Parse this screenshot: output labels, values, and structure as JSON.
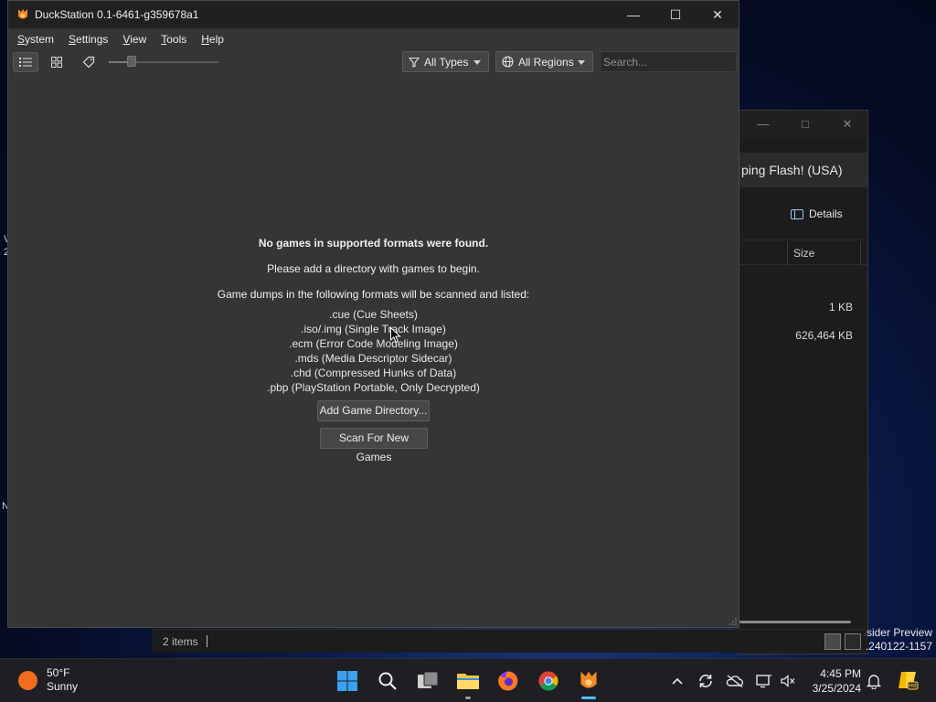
{
  "desktop": {
    "edge_a": "V",
    "edge_b": "2",
    "edge_c": "N",
    "insider_line1": "sider Preview",
    "insider_line2": ".240122-1157"
  },
  "explorer": {
    "address_text": "ping Flash! (USA)",
    "details_label": "Details",
    "size_header": "Size",
    "rows": [
      {
        "size": "1 KB"
      },
      {
        "size": "626,464 KB"
      }
    ],
    "status_items": "2 items"
  },
  "duckstation": {
    "title": "DuckStation 0.1-6461-g359678a1",
    "menu": [
      {
        "label": "System",
        "mnemonic_index": 0
      },
      {
        "label": "Settings",
        "mnemonic_index": 0
      },
      {
        "label": "View",
        "mnemonic_index": 0
      },
      {
        "label": "Tools",
        "mnemonic_index": 0
      },
      {
        "label": "Help",
        "mnemonic_index": 0
      }
    ],
    "toolbar": {
      "type_filter": "All Types",
      "region_filter": "All Regions",
      "search_placeholder": "Search...",
      "zoom_level": 0.17
    },
    "empty_state": {
      "heading": "No games in supported formats were found.",
      "line1": "Please add a directory with games to begin.",
      "line2": "Game dumps in the following formats will be scanned and listed:",
      "formats": [
        ".cue (Cue Sheets)",
        ".iso/.img (Single Track Image)",
        ".ecm (Error Code Modeling Image)",
        ".mds (Media Descriptor Sidecar)",
        ".chd (Compressed Hunks of Data)",
        ".pbp (PlayStation Portable, Only Decrypted)"
      ],
      "add_button": "Add Game Directory...",
      "scan_button": "Scan For New Games"
    }
  },
  "taskbar": {
    "weather_temp": "50°F",
    "weather_desc": "Sunny",
    "time": "4:45 PM",
    "date": "3/25/2024"
  },
  "colors": {
    "window_bg": "#353535",
    "titlebar_bg": "#202020",
    "taskbar_bg": "#1f1f23",
    "accent": "#4cc2ff",
    "duck_orange": "#f08a24"
  }
}
